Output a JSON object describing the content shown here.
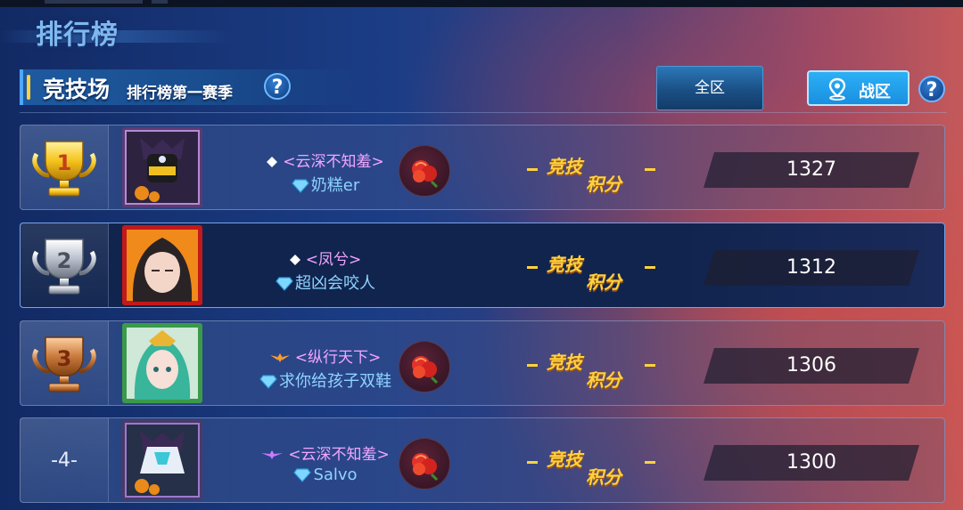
{
  "page": {
    "title": "排行榜"
  },
  "season": {
    "title": "竞技场",
    "subtitle": "排行榜第一赛季"
  },
  "tabs": {
    "all": "全区",
    "zone": "战区"
  },
  "score_label": {
    "line1": "竞技",
    "line2": "积分"
  },
  "rows": [
    {
      "rank": "1",
      "rank_style": "gold",
      "guild_icon": "white-diamond-icon",
      "guild": "<云深不知羞>",
      "player": "奶糕er",
      "has_rose": true,
      "score": "1327"
    },
    {
      "rank": "2",
      "rank_style": "silver",
      "guild_icon": "white-diamond-icon",
      "guild": "<凤兮>",
      "player": "超凶会咬人",
      "has_rose": false,
      "score": "1312"
    },
    {
      "rank": "3",
      "rank_style": "bronze",
      "guild_icon": "orange-wings-icon",
      "guild": "<纵行天下>",
      "player": "求你给孩子双鞋",
      "has_rose": true,
      "score": "1306"
    },
    {
      "rank": "-4-",
      "rank_style": "text",
      "guild_icon": "purple-wings-icon",
      "guild": "<云深不知羞>",
      "player": "Salvo",
      "has_rose": true,
      "score": "1300"
    }
  ],
  "colors": {
    "gold": "#ffd23b",
    "guild_text": "#f2a6ff",
    "player_text": "#8fd3ff",
    "zone_tab": "#1a8fe0"
  }
}
